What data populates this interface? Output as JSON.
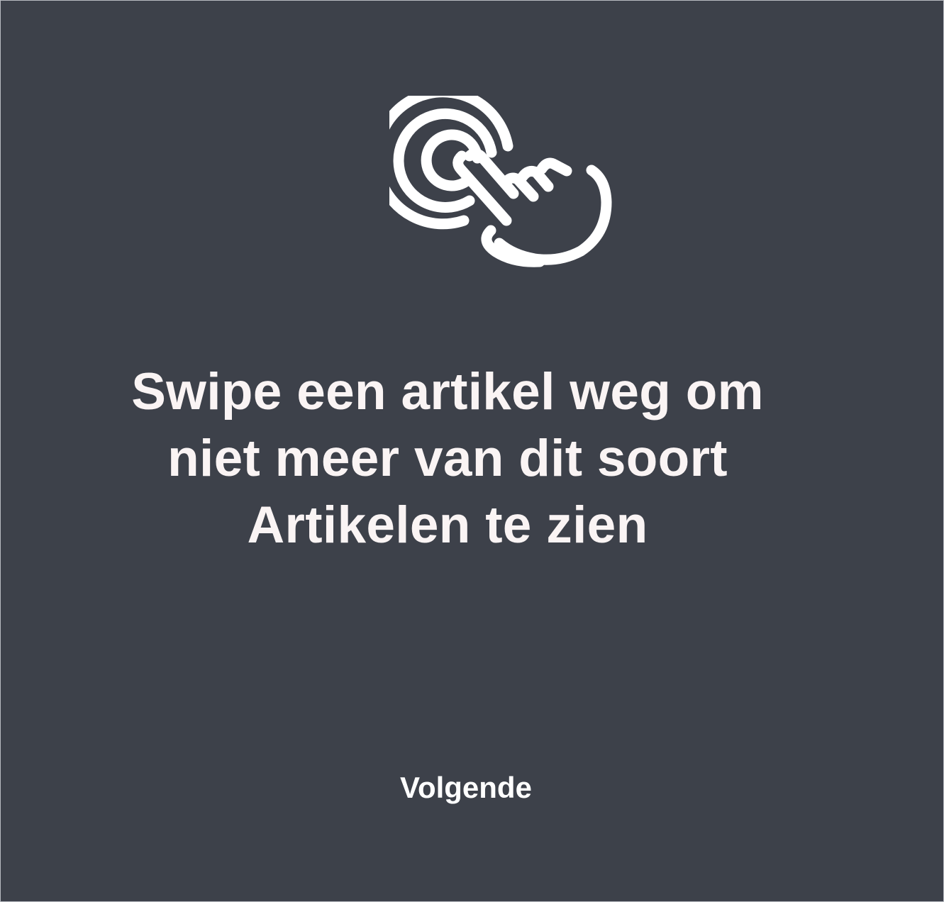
{
  "screen": {
    "background_color": "#3d414a",
    "text_color": "#faf4f4"
  },
  "hint": {
    "icon": "tap-gesture-icon",
    "message_lines": [
      "Swipe een artikel weg om",
      "niet meer van dit soort",
      "Artikelen te zien"
    ]
  },
  "actions": {
    "next_label": "Volgende"
  }
}
